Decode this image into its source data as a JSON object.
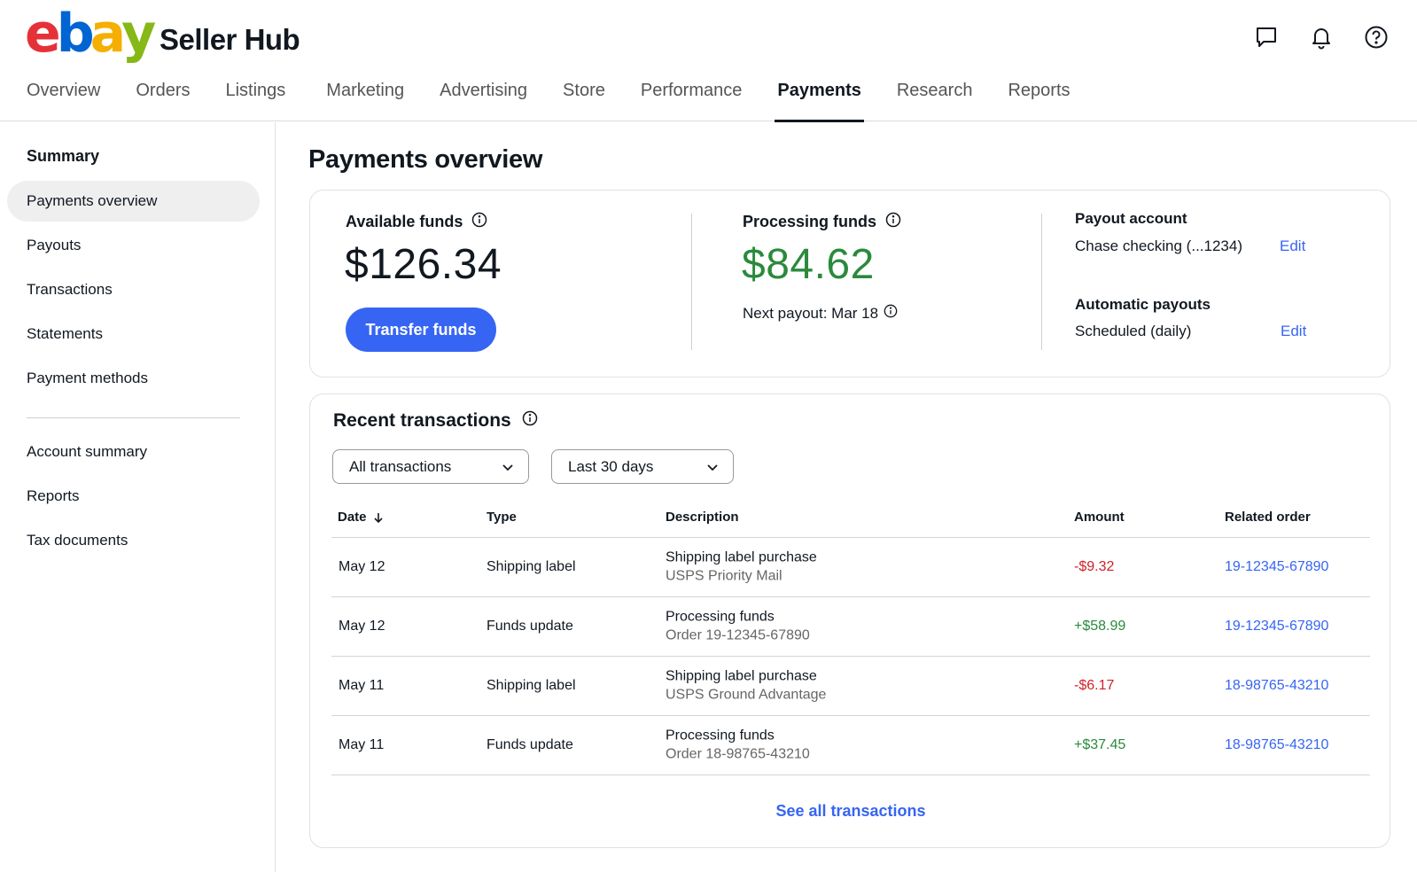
{
  "brand": {
    "logo_letters": [
      "e",
      "b",
      "a",
      "y"
    ],
    "logo_colors": [
      "#e53238",
      "#0064d2",
      "#f5af02",
      "#86b817"
    ],
    "app_title": "Seller Hub"
  },
  "header_icons": [
    "chat-icon",
    "bell-icon",
    "help-icon"
  ],
  "nav": {
    "tabs": [
      "Overview",
      "Orders",
      "Listings",
      "Marketing",
      "Advertising",
      "Store",
      "Performance",
      "Payments",
      "Research",
      "Reports"
    ],
    "active": "Payments"
  },
  "sidebar": {
    "section_title": "Summary",
    "items": [
      "Payments overview",
      "Payouts",
      "Transactions",
      "Statements",
      "Payment methods"
    ],
    "active": "Payments overview",
    "secondary_items": [
      "Account summary",
      "Reports",
      "Tax documents"
    ]
  },
  "page": {
    "title": "Payments overview"
  },
  "summary": {
    "available_label": "Available funds",
    "available_amount": "$126.34",
    "transfer_button": "Transfer funds",
    "processing_label": "Processing funds",
    "processing_amount": "$84.62",
    "next_payout": "Next payout: Mar 18",
    "payout_account_label": "Payout account",
    "payout_account_value": "Chase checking (...1234)",
    "auto_payouts_label": "Automatic payouts",
    "auto_payouts_value": "Scheduled (daily)",
    "edit_label": "Edit"
  },
  "transactions": {
    "title": "Recent transactions",
    "filter_type": "All transactions",
    "filter_range": "Last 30 days",
    "columns": [
      "Date",
      "Type",
      "Description",
      "Amount",
      "Related order"
    ],
    "rows": [
      {
        "date": "May 12",
        "type": "Shipping label",
        "desc": "Shipping label purchase",
        "desc_sub": "USPS Priority Mail",
        "amount": "-$9.32",
        "sign": "neg",
        "order": "19-12345-67890"
      },
      {
        "date": "May 12",
        "type": "Funds update",
        "desc": "Processing funds",
        "desc_sub": "Order 19-12345-67890",
        "amount": "+$58.99",
        "sign": "pos",
        "order": "19-12345-67890"
      },
      {
        "date": "May 11",
        "type": "Shipping label",
        "desc": "Shipping label purchase",
        "desc_sub": "USPS Ground Advantage",
        "amount": "-$6.17",
        "sign": "neg",
        "order": "18-98765-43210"
      },
      {
        "date": "May 11",
        "type": "Funds update",
        "desc": "Processing funds",
        "desc_sub": "Order 18-98765-43210",
        "amount": "+$37.45",
        "sign": "pos",
        "order": "18-98765-43210"
      }
    ],
    "see_all": "See all transactions"
  },
  "colors": {
    "accent": "#3665f3",
    "positive": "#2a8a3c",
    "negative": "#d0202a"
  }
}
